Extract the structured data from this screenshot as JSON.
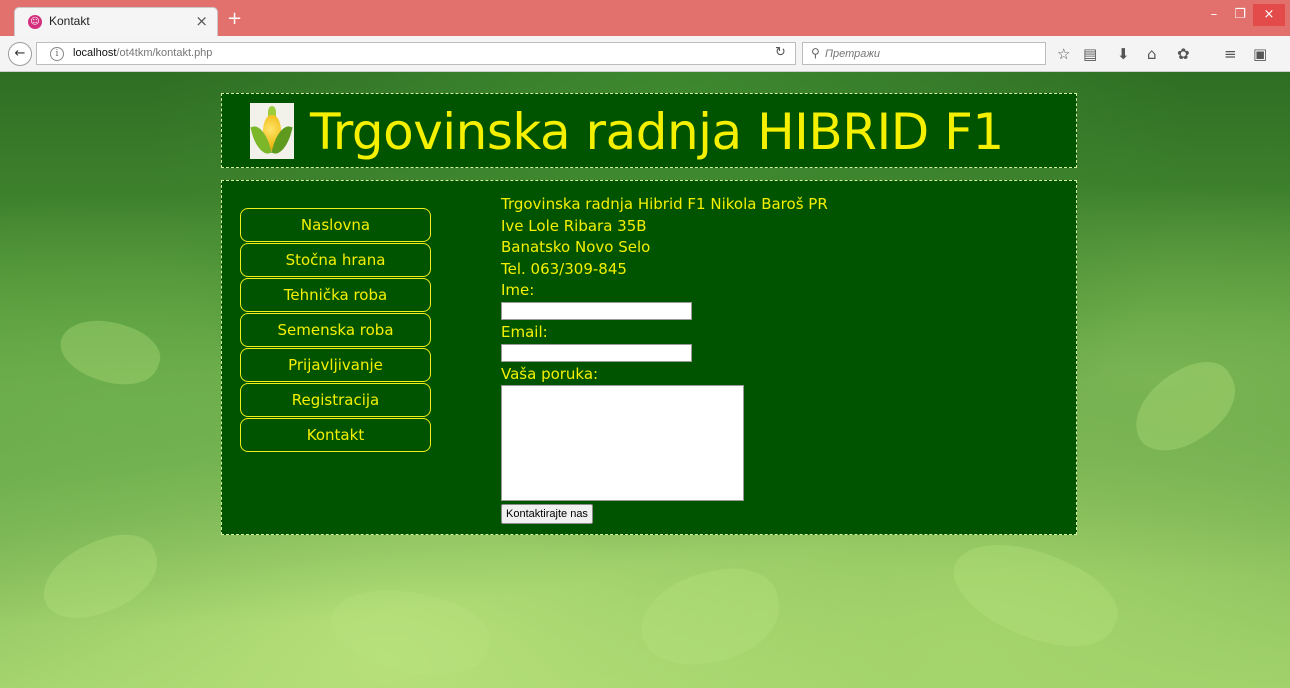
{
  "browser": {
    "tab_title": "Kontakt",
    "tab_close": "×",
    "new_tab": "+",
    "window_controls": {
      "minimize": "–",
      "maximize": "❐",
      "close": "×"
    },
    "url_host": "localhost",
    "url_path": "/ot4tkm/kontakt.php",
    "search_placeholder": "Претражи",
    "icons": [
      "back-icon",
      "info-icon",
      "reload-icon",
      "search-icon",
      "bookmark-star-icon",
      "reading-list-icon",
      "download-icon",
      "home-icon",
      "addon-icon",
      "menu-icon",
      "extension-icon"
    ]
  },
  "header": {
    "title": "Trgovinska radnja HIBRID F1",
    "logo": "corn-logo"
  },
  "menu": {
    "items": [
      {
        "label": "Naslovna"
      },
      {
        "label": "Stočna hrana"
      },
      {
        "label": "Tehnička roba"
      },
      {
        "label": "Semenska roba"
      },
      {
        "label": "Prijavljivanje"
      },
      {
        "label": "Registracija"
      },
      {
        "label": "Kontakt"
      }
    ]
  },
  "contact": {
    "company": "Trgovinska radnja Hibrid F1 Nikola Baroš PR",
    "street": "Ive Lole Ribara 35B",
    "city": "Banatsko Novo Selo",
    "phone": "Tel. 063/309-845"
  },
  "form": {
    "name_label": "Ime:",
    "name_value": "",
    "email_label": "Email:",
    "email_value": "",
    "message_label": "Vaša poruka:",
    "message_value": "",
    "submit_label": "Kontaktirajte nas"
  },
  "colors": {
    "box_background": "#005400",
    "text_accent": "#f5f000",
    "tab_bar": "#e2706c"
  }
}
